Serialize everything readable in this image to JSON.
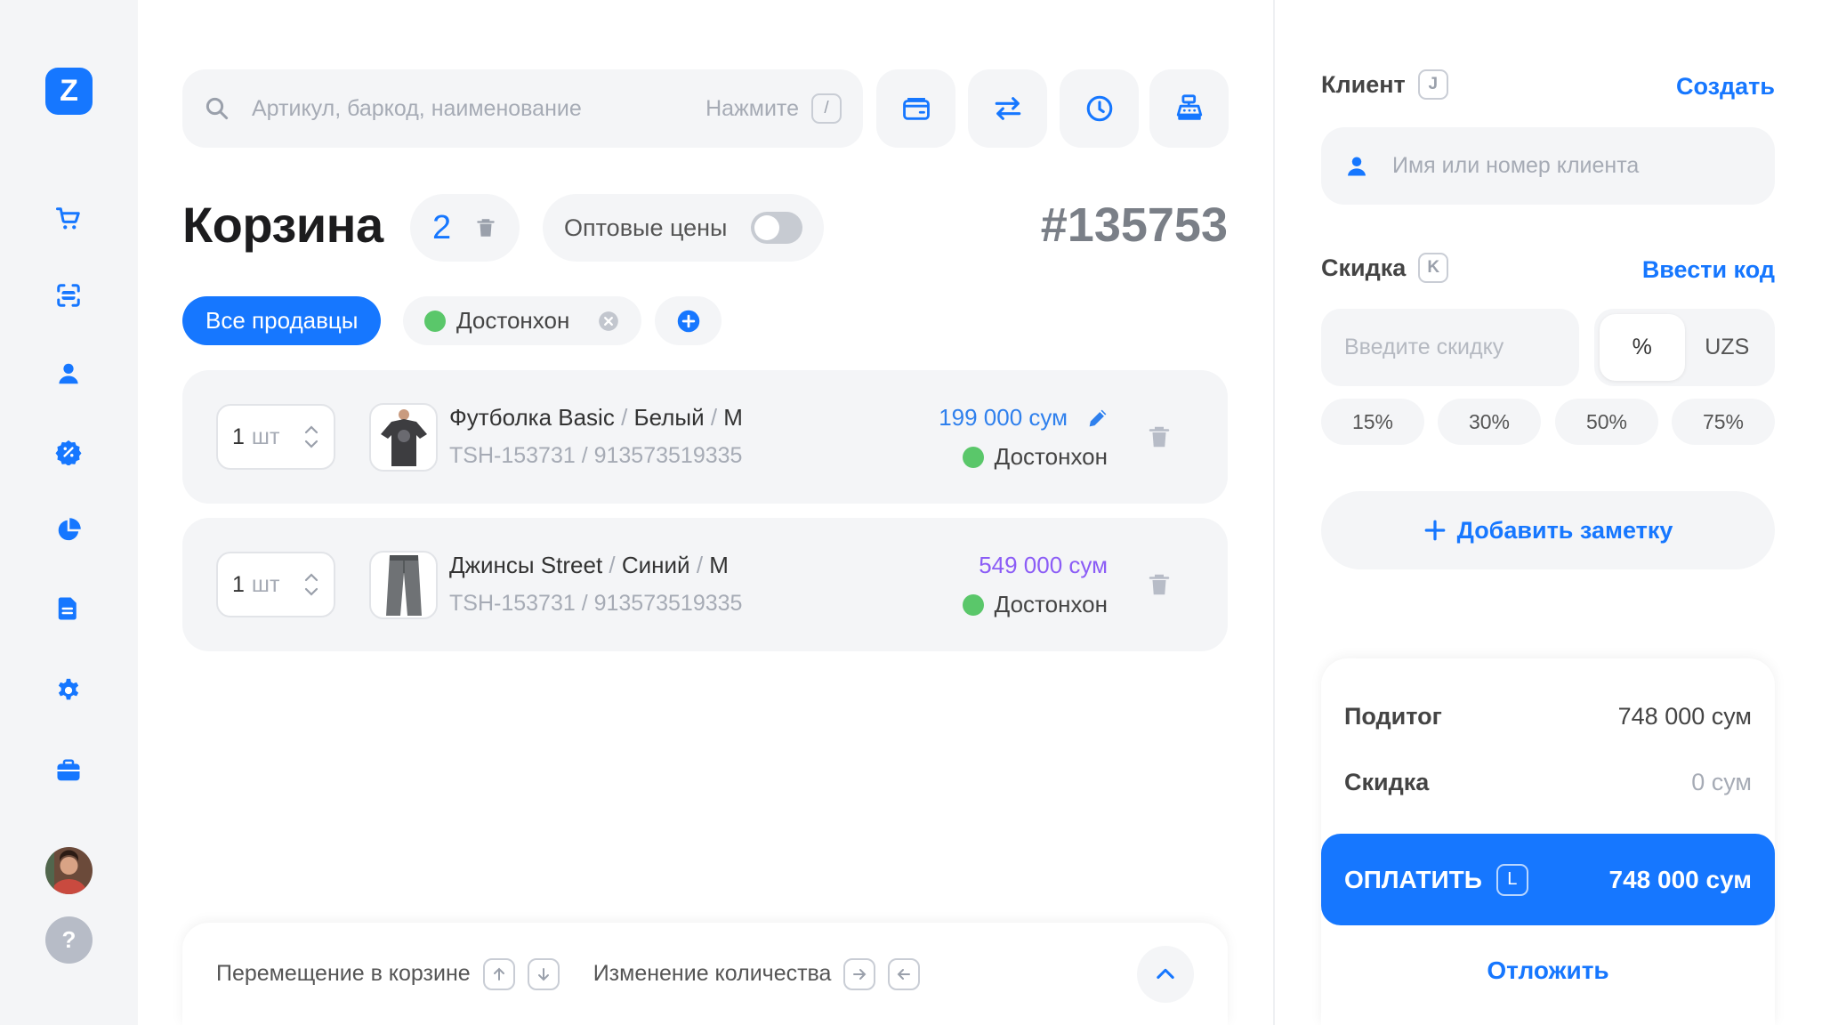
{
  "sidebar": {
    "logo": "Z",
    "items": [
      {
        "name": "cart-icon"
      },
      {
        "name": "scanner-icon"
      },
      {
        "name": "user-icon"
      },
      {
        "name": "discount-badge-icon"
      },
      {
        "name": "pie-chart-icon"
      },
      {
        "name": "document-icon"
      },
      {
        "name": "gear-icon"
      },
      {
        "name": "briefcase-icon"
      }
    ],
    "help": "?"
  },
  "search": {
    "placeholder": "Артикул, баркод, наименование",
    "hint": "Нажмите",
    "hint_key": "/"
  },
  "toolbar": {
    "icons": [
      "wallet-icon",
      "transfer-icon",
      "clock-icon",
      "cash-register-icon"
    ]
  },
  "cart": {
    "title": "Корзина",
    "count": "2",
    "wholesale_label": "Оптовые цены",
    "order_number": "#135753"
  },
  "sellers": {
    "all_label": "Все продавцы",
    "chip_label": "Достонхон"
  },
  "items": [
    {
      "qty": "1",
      "unit": "шт",
      "name": "Футболка Basic",
      "color": "Белый",
      "size": "M",
      "sku": "TSH-153731 / 913573519335",
      "price": "199 000 сум",
      "price_color": "#2f80ed",
      "seller": "Достонхон"
    },
    {
      "qty": "1",
      "unit": "шт",
      "name": "Джинсы Street",
      "color": "Синий",
      "size": "M",
      "sku": "TSH-153731 / 913573519335",
      "price": "549 000 сум",
      "price_color": "#8b5cf6",
      "seller": "Достонхон"
    }
  ],
  "shortcuts": {
    "move_label": "Перемещение в корзине",
    "qty_label": "Изменение количества"
  },
  "client": {
    "label": "Клиент",
    "key": "J",
    "create": "Создать",
    "placeholder": "Имя или номер клиента"
  },
  "discount": {
    "label": "Скидка",
    "key": "K",
    "enter_code": "Ввести код",
    "placeholder": "Введите скидку",
    "unit_percent": "%",
    "unit_currency": "UZS",
    "presets": [
      "15%",
      "30%",
      "50%",
      "75%"
    ]
  },
  "note": {
    "add_label": "Добавить заметку"
  },
  "summary": {
    "subtotal_label": "Подитог",
    "subtotal_value": "748 000 сум",
    "discount_label": "Скидка",
    "discount_value": "0 сум",
    "pay_label": "ОПЛАТИТЬ",
    "pay_key": "L",
    "pay_amount": "748 000 сум",
    "postpone": "Отложить"
  },
  "colors": {
    "accent": "#1677ff",
    "seller_dot": "#5ac76a",
    "muted": "#a6abb5"
  }
}
